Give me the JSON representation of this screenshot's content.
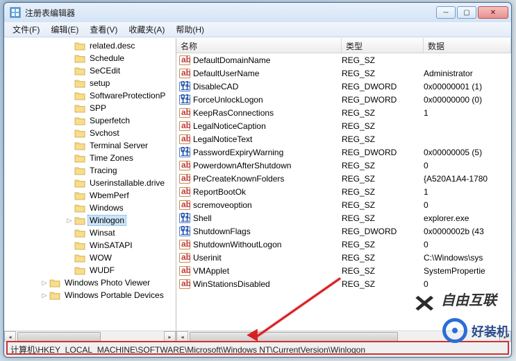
{
  "window": {
    "title": "注册表编辑器"
  },
  "menus": {
    "file": "文件(F)",
    "edit": "编辑(E)",
    "view": "查看(V)",
    "favorites": "收藏夹(A)",
    "help": "帮助(H)"
  },
  "tree": {
    "items": [
      {
        "ind": 88,
        "exp": "",
        "label": "related.desc"
      },
      {
        "ind": 88,
        "exp": "",
        "label": "Schedule"
      },
      {
        "ind": 88,
        "exp": "",
        "label": "SeCEdit"
      },
      {
        "ind": 88,
        "exp": "",
        "label": "setup"
      },
      {
        "ind": 88,
        "exp": "",
        "label": "SoftwareProtectionP"
      },
      {
        "ind": 88,
        "exp": "",
        "label": "SPP"
      },
      {
        "ind": 88,
        "exp": "",
        "label": "Superfetch"
      },
      {
        "ind": 88,
        "exp": "",
        "label": "Svchost"
      },
      {
        "ind": 88,
        "exp": "",
        "label": "Terminal Server"
      },
      {
        "ind": 88,
        "exp": "",
        "label": "Time Zones"
      },
      {
        "ind": 88,
        "exp": "",
        "label": "Tracing"
      },
      {
        "ind": 88,
        "exp": "",
        "label": "Userinstallable.drive"
      },
      {
        "ind": 88,
        "exp": "",
        "label": "WbemPerf"
      },
      {
        "ind": 88,
        "exp": "",
        "label": "Windows"
      },
      {
        "ind": 88,
        "exp": "▷",
        "label": "Winlogon",
        "selected": true
      },
      {
        "ind": 88,
        "exp": "",
        "label": "Winsat"
      },
      {
        "ind": 88,
        "exp": "",
        "label": "WinSATAPI"
      },
      {
        "ind": 88,
        "exp": "",
        "label": "WOW"
      },
      {
        "ind": 88,
        "exp": "",
        "label": "WUDF"
      },
      {
        "ind": 52,
        "exp": "▷",
        "label": "Windows Photo Viewer",
        "bottom": true
      },
      {
        "ind": 52,
        "exp": "▷",
        "label": "Windows Portable Devices",
        "bottom": true
      }
    ]
  },
  "list": {
    "headers": {
      "name": "名称",
      "type": "类型",
      "data": "数据"
    },
    "rows": [
      {
        "icon": "str",
        "name": "DefaultDomainName",
        "type": "REG_SZ",
        "data": ""
      },
      {
        "icon": "str",
        "name": "DefaultUserName",
        "type": "REG_SZ",
        "data": "Administrator"
      },
      {
        "icon": "bin",
        "name": "DisableCAD",
        "type": "REG_DWORD",
        "data": "0x00000001 (1)"
      },
      {
        "icon": "bin",
        "name": "ForceUnlockLogon",
        "type": "REG_DWORD",
        "data": "0x00000000 (0)"
      },
      {
        "icon": "str",
        "name": "KeepRasConnections",
        "type": "REG_SZ",
        "data": "1"
      },
      {
        "icon": "str",
        "name": "LegalNoticeCaption",
        "type": "REG_SZ",
        "data": ""
      },
      {
        "icon": "str",
        "name": "LegalNoticeText",
        "type": "REG_SZ",
        "data": ""
      },
      {
        "icon": "bin",
        "name": "PasswordExpiryWarning",
        "type": "REG_DWORD",
        "data": "0x00000005 (5)"
      },
      {
        "icon": "str",
        "name": "PowerdownAfterShutdown",
        "type": "REG_SZ",
        "data": "0"
      },
      {
        "icon": "str",
        "name": "PreCreateKnownFolders",
        "type": "REG_SZ",
        "data": "{A520A1A4-1780"
      },
      {
        "icon": "str",
        "name": "ReportBootOk",
        "type": "REG_SZ",
        "data": "1"
      },
      {
        "icon": "str",
        "name": "scremoveoption",
        "type": "REG_SZ",
        "data": "0"
      },
      {
        "icon": "bin",
        "name": "Shell",
        "type": "REG_SZ",
        "data": "explorer.exe"
      },
      {
        "icon": "bin",
        "name": "ShutdownFlags",
        "type": "REG_DWORD",
        "data": "0x0000002b (43"
      },
      {
        "icon": "str",
        "name": "ShutdownWithoutLogon",
        "type": "REG_SZ",
        "data": "0"
      },
      {
        "icon": "str",
        "name": "Userinit",
        "type": "REG_SZ",
        "data": "C:\\Windows\\sys"
      },
      {
        "icon": "str",
        "name": "VMApplet",
        "type": "REG_SZ",
        "data": "SystemPropertie"
      },
      {
        "icon": "str",
        "name": "WinStationsDisabled",
        "type": "REG_SZ",
        "data": "0"
      }
    ]
  },
  "statusbar": {
    "path": "计算机\\HKEY_LOCAL_MACHINE\\SOFTWARE\\Microsoft\\Windows NT\\CurrentVersion\\Winlogon"
  },
  "watermarks": {
    "w1": "自由互联",
    "w2": "好装机"
  }
}
